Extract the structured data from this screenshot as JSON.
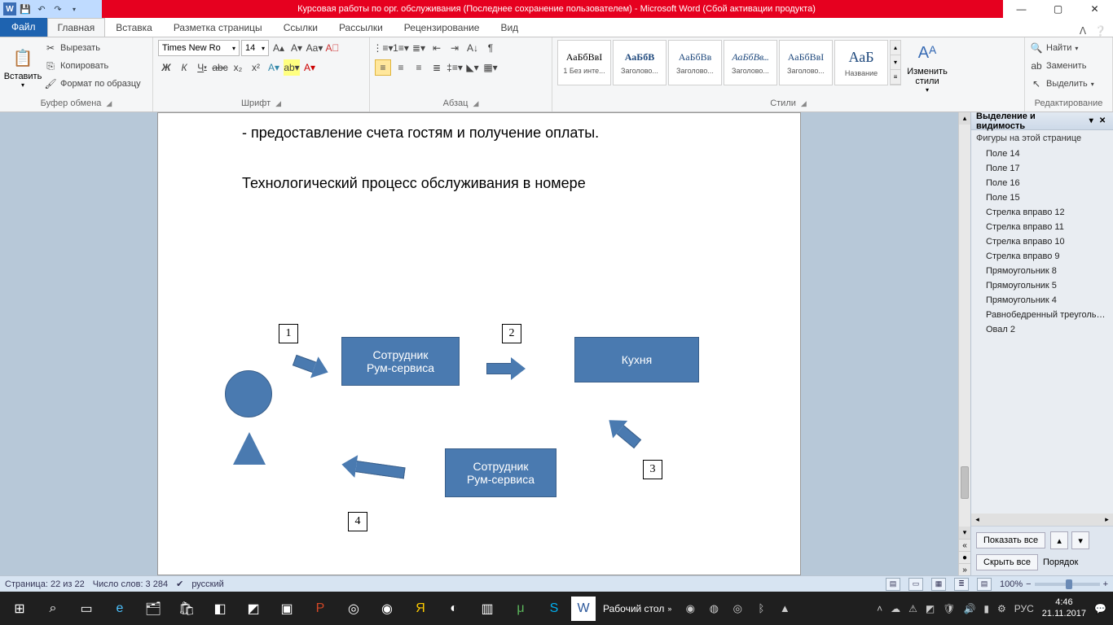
{
  "title": "Курсовая работы по орг. обслуживания (Последнее сохранение пользователем)  -  Microsoft Word (Сбой активации продукта)",
  "tabs": {
    "file": "Файл",
    "items": [
      "Главная",
      "Вставка",
      "Разметка страницы",
      "Ссылки",
      "Рассылки",
      "Рецензирование",
      "Вид"
    ]
  },
  "clipboard": {
    "paste": "Вставить",
    "cut": "Вырезать",
    "copy": "Копировать",
    "format_painter": "Формат по образцу",
    "label": "Буфер обмена"
  },
  "font": {
    "name": "Times New Ro",
    "size": "14",
    "label": "Шрифт"
  },
  "paragraph": {
    "label": "Абзац"
  },
  "styles": {
    "change": "Изменить стили",
    "label": "Стили",
    "items": [
      {
        "sample": "АаБбВвІ",
        "name": "1 Без инте..."
      },
      {
        "sample": "АаБбВ",
        "name": "Заголово..."
      },
      {
        "sample": "АаБбВв",
        "name": "Заголово..."
      },
      {
        "sample": "АаБбВв...",
        "name": "Заголово..."
      },
      {
        "sample": "АаБбВвІ",
        "name": "Заголово..."
      },
      {
        "sample": "АаБ",
        "name": "Название"
      }
    ]
  },
  "editing": {
    "find": "Найти",
    "replace": "Заменить",
    "select": "Выделить",
    "label": "Редактирование"
  },
  "document": {
    "line1": "- предоставление счета гостям и получение оплаты.",
    "heading": "Технологический процесс обслуживания в номере",
    "box1_l1": "Сотрудник",
    "box1_l2": "Рум-сервиса",
    "box2": "Кухня",
    "box3_l1": "Сотрудник",
    "box3_l2": "Рум-сервиса",
    "n1": "1",
    "n2": "2",
    "n3": "3",
    "n4": "4"
  },
  "selection_pane": {
    "title": "Выделение и видимость",
    "subtitle": "Фигуры на этой странице",
    "items": [
      "Поле 14",
      "Поле 17",
      "Поле 16",
      "Поле 15",
      "Стрелка вправо 12",
      "Стрелка вправо 11",
      "Стрелка вправо 10",
      "Стрелка вправо 9",
      "Прямоугольник 8",
      "Прямоугольник 5",
      "Прямоугольник 4",
      "Равнобедренный треугольник",
      "Овал 2"
    ],
    "show_all": "Показать все",
    "hide_all": "Скрыть все",
    "order": "Порядок"
  },
  "status": {
    "page": "Страница: 22 из 22",
    "words": "Число слов: 3 284",
    "lang": "русский",
    "zoom": "100%"
  },
  "taskbar": {
    "desktop": "Рабочий стол",
    "lang": "РУС",
    "time": "4:46",
    "date": "21.11.2017"
  }
}
